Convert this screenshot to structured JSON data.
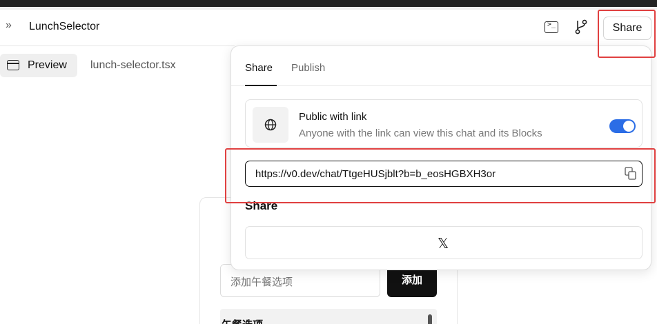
{
  "header": {
    "toggle_glyph": "»",
    "title": "LunchSelector",
    "share_label": "Share"
  },
  "tabs": {
    "preview_label": "Preview",
    "file_label": "lunch-selector.tsx"
  },
  "popover": {
    "tab_share": "Share",
    "tab_publish": "Publish",
    "visibility_title": "Public with link",
    "visibility_desc": "Anyone with the link can view this chat and its Blocks",
    "visibility_enabled": true,
    "share_url": "https://v0.dev/chat/TtgeHUSjblt?b=b_eosHGBXH3or",
    "share_heading": "Share",
    "x_glyph": "𝕏"
  },
  "background_app": {
    "input_placeholder": "添加午餐选项",
    "add_label": "添加",
    "list_heading": "午餐选项"
  },
  "colors": {
    "accent_toggle": "#2b6de6",
    "highlight": "#e04040"
  }
}
